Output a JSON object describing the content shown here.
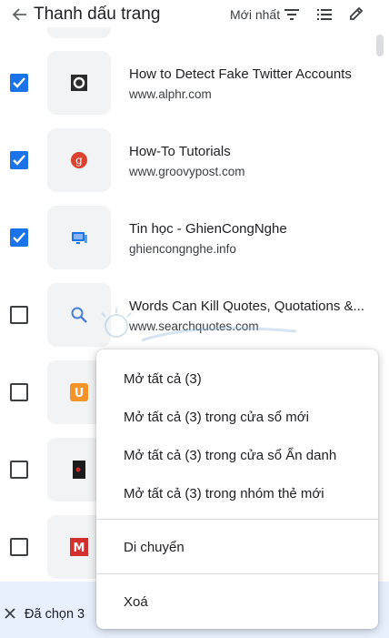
{
  "header": {
    "title": "Thanh dấu trang",
    "sort_label": "Mới nhất"
  },
  "bookmarks": [
    {
      "title": "How to Detect Fake Twitter Accounts",
      "url": "www.alphr.com",
      "checked": true,
      "favicon": "alphr-icon"
    },
    {
      "title": "How-To Tutorials",
      "url": "www.groovypost.com",
      "checked": true,
      "favicon": "groovypost-icon"
    },
    {
      "title": "Tin học - GhienCongNghe",
      "url": "ghiencongnghe.info",
      "checked": true,
      "favicon": "ghiencongnghe-icon"
    },
    {
      "title": "Words Can Kill Quotes, Quotations &...",
      "url": "www.searchquotes.com",
      "checked": false,
      "favicon": "search-icon"
    },
    {
      "title": "",
      "url": "",
      "checked": false,
      "favicon": "u-icon"
    },
    {
      "title": "",
      "url": "",
      "checked": false,
      "favicon": "dark-icon"
    },
    {
      "title": "",
      "url": "",
      "checked": false,
      "favicon": "m-icon"
    }
  ],
  "context_menu": {
    "open_all": "Mở tất cả (3)",
    "open_all_new_window": "Mở tất cả (3) trong cửa sổ mới",
    "open_all_incognito": "Mở tất cả (3) trong cửa sổ Ẩn danh",
    "open_all_new_group": "Mở tất cả (3) trong nhóm thẻ mới",
    "move": "Di chuyển",
    "delete": "Xoá"
  },
  "selection_bar": {
    "label": "Đã chọn 3"
  },
  "colors": {
    "accent": "#1a73e8",
    "thumb_bg": "#f1f3f4",
    "selection_bg": "#e8f0fe"
  }
}
